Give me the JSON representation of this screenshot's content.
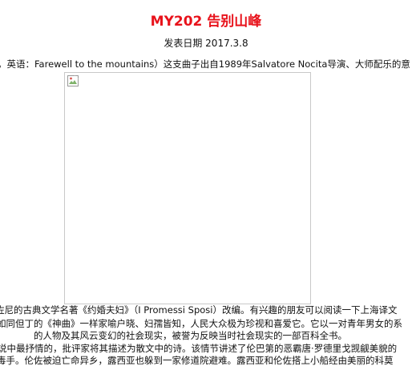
{
  "article": {
    "title": "MY202 告别山峰",
    "date": "发表日期 2017.3.8",
    "intro_line": "，英语：Farewell to the mountains）这支曲子出自1989年Salvatore Nocita导演、大师配乐的意",
    "image": {
      "state": "broken",
      "icon": "broken-image-icon"
    },
    "paragraph_lines": [
      "佐尼的古典文学名著《约婚夫妇》（I Promessi Sposi）改编。有兴趣的朋友可以阅读一下上海译文",
      "如同但丁的《神曲》一样家喻户晓、妇孺皆知，人民大众极为珍视和喜爱它。它以一对青年男女的系",
      "的人物及其风云变幻的社会现实，被誉为反映当时社会现实的一部百科全书。",
      "说中最抒情的，批评家将其描述为散文中的诗。该情节讲述了伦巴第的恶霸唐·罗德里戈觊觎美貌的",
      "毒手。伦佐被迫亡命异乡，露西亚也躲到一家修道院避难。露西亚和伦佐搭上小船经由美丽的科莫"
    ]
  }
}
